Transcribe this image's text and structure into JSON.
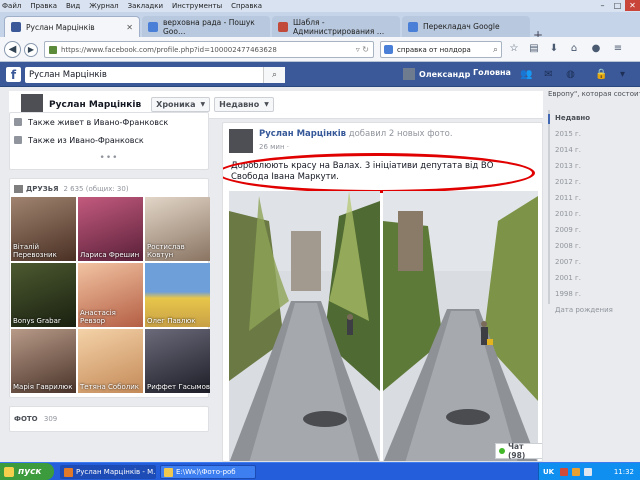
{
  "menubar": {
    "items": [
      "Файл",
      "Правка",
      "Вид",
      "Журнал",
      "Закладки",
      "Инструменты",
      "Справка"
    ]
  },
  "window_controls": {
    "minimize": "–",
    "maximize": "□",
    "close": "✕"
  },
  "tabs": [
    {
      "label": "Руслан Марцінків",
      "active": true
    },
    {
      "label": "верховна рада - Пошук Goo…",
      "active": false
    },
    {
      "label": "Шабля - Администрирования …",
      "active": false
    },
    {
      "label": "Перекладач Google",
      "active": false
    }
  ],
  "nav": {
    "url": "https://www.facebook.com/profile.php?id=100002477463628",
    "search_query": "справка от нолдора"
  },
  "fb": {
    "search_value": "Руслан Марцінків",
    "user_name": "Олександр",
    "home_label": "Головна"
  },
  "profile": {
    "name": "Руслан Марцінків",
    "timeline_button": "Хроника",
    "recent_button": "Недавно"
  },
  "about": {
    "lives_in": "Также живет в Ивано-Франковск",
    "from": "Также из Ивано-Франковск",
    "more": "•••"
  },
  "friends": {
    "title": "ДРУЗЬЯ",
    "count": "2 635 (общих: 30)",
    "items": [
      {
        "name": "Віталій Перевозник",
        "bg": "#6a4a3a"
      },
      {
        "name": "Лариса Фрешин",
        "bg": "#9a3a5a"
      },
      {
        "name": "Ростислав Ковтун",
        "bg": "#c9b7a5"
      },
      {
        "name": "Bonys Grabar",
        "bg": "#2f3a1f"
      },
      {
        "name": "Анастасія Ревзор",
        "bg": "#d88a6a"
      },
      {
        "name": "Олег Павлюк",
        "bg": "#c8a046"
      },
      {
        "name": "Марія Гаврилюк",
        "bg": "#8a6a5a"
      },
      {
        "name": "Тетяна Соболик",
        "bg": "#e2b488"
      },
      {
        "name": "Риффет Гасымов",
        "bg": "#3a3a4a"
      }
    ]
  },
  "photos": {
    "title": "ФОТО",
    "count": "309"
  },
  "post": {
    "author": "Руслан Марцінків",
    "action": "добавил 2 новых фото.",
    "time": "26 мин · ",
    "text": "Дороблюють красу на Валах. 3 ініціативи депутата від ВО Свобода Івана Маркути."
  },
  "chat": {
    "label": "Чат (98)"
  },
  "timeline": {
    "top_text": "Европу\", которая состоит",
    "items": [
      "Недавно",
      "2015 г.",
      "2014 г.",
      "2013 г.",
      "2012 г.",
      "2011 г.",
      "2010 г.",
      "2009 г.",
      "2008 г.",
      "2007 г.",
      "2001 г.",
      "1998 г.",
      "Дата рождения"
    ]
  },
  "taskbar": {
    "start": "пуск",
    "tasks": [
      {
        "label": "Руслан Марцінків - М…",
        "active": true
      },
      {
        "label": "E:\\Wк)\\Фото-роб",
        "active": false
      }
    ],
    "lang": "UK",
    "clock": "11:32"
  },
  "colors": {
    "fb_blue": "#3b5998",
    "highlight_red": "#e00000",
    "link_blue": "#365899",
    "taskbar_blue": "#245edb",
    "start_green": "#3c9b3c"
  }
}
